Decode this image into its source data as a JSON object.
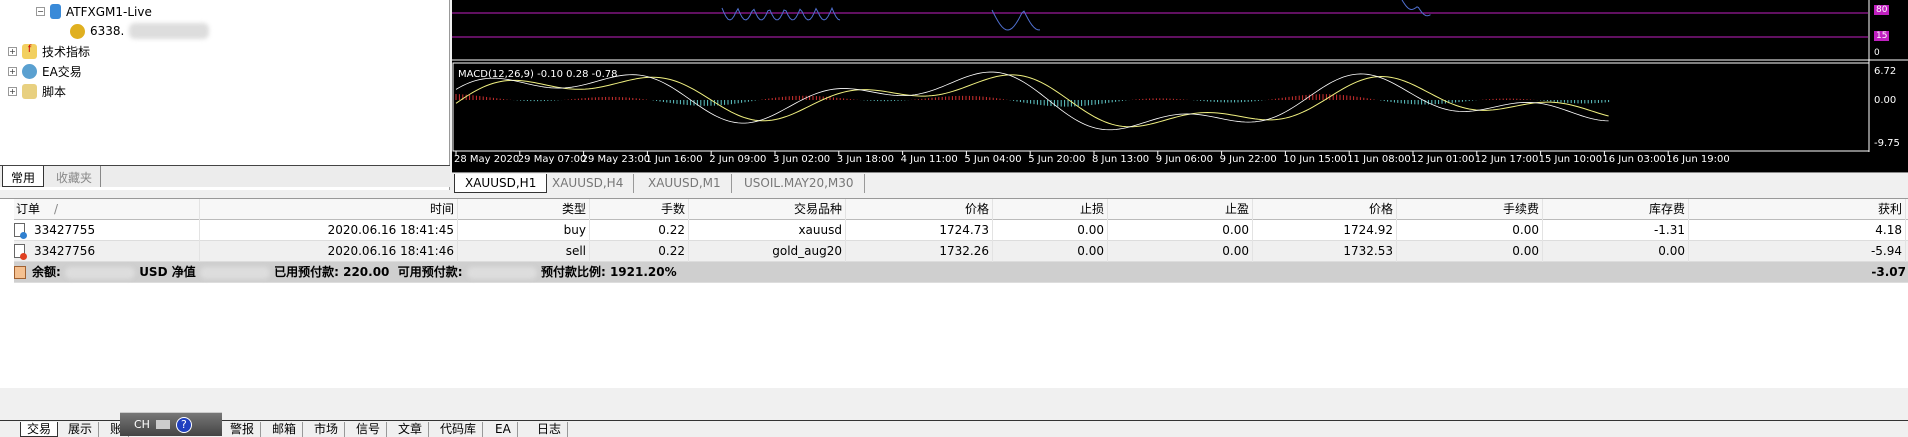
{
  "navigator": {
    "server": "ATFXGM1-Live",
    "account": "6338.",
    "items": [
      {
        "label": "技术指标"
      },
      {
        "label": "EA交易"
      },
      {
        "label": "脚本"
      }
    ],
    "tabs": [
      "常用",
      "收藏夹"
    ]
  },
  "chart": {
    "rsi_levels": [
      "80",
      "15",
      "0"
    ],
    "macd_label": "MACD(12,26,9) -0.10 0.28 -0.78",
    "macd_axis": [
      "6.72",
      "0.00",
      "-9.75"
    ],
    "time_labels": [
      "28 May 2020",
      "29 May 07:00",
      "29 May 23:00",
      "1 Jun 16:00",
      "2 Jun 09:00",
      "3 Jun 02:00",
      "3 Jun 18:00",
      "4 Jun 11:00",
      "5 Jun 04:00",
      "5 Jun 20:00",
      "8 Jun 13:00",
      "9 Jun 06:00",
      "9 Jun 22:00",
      "10 Jun 15:00",
      "11 Jun 08:00",
      "12 Jun 01:00",
      "12 Jun 17:00",
      "15 Jun 10:00",
      "16 Jun 03:00",
      "16 Jun 19:00"
    ],
    "tabs": [
      "XAUUSD,H1",
      "XAUUSD,H4",
      "XAUUSD,M1",
      "USOIL.MAY20,M30"
    ],
    "colors": {
      "bull": "#d03030",
      "bear": "#60c8c8",
      "signal": "#f0f080",
      "main": "#ffffff",
      "level": "#c020c0"
    }
  },
  "trade": {
    "headers": [
      "订单",
      "时间",
      "类型",
      "手数",
      "交易品种",
      "价格",
      "止损",
      "止盈",
      "价格",
      "手续费",
      "库存费",
      "获利"
    ],
    "sort_indicator": "/",
    "rows": [
      {
        "cells": [
          "33427755",
          "2020.06.16 18:41:45",
          "buy",
          "0.22",
          "xauusd",
          "1724.73",
          "0.00",
          "0.00",
          "1724.92",
          "0.00",
          "-1.31",
          "4.18"
        ]
      },
      {
        "cells": [
          "33427756",
          "2020.06.16 18:41:46",
          "sell",
          "0.22",
          "gold_aug20",
          "1732.26",
          "0.00",
          "0.00",
          "1732.53",
          "0.00",
          "0.00",
          "-5.94"
        ]
      }
    ],
    "summary": {
      "balance_label": "余额:",
      "currency": "USD",
      "equity_label": "净值",
      "margin_label": "已用预付款: 220.00",
      "free_label": "可用预付款:",
      "level_label": "预付款比例: 1921.20%",
      "total": "-3.07"
    }
  },
  "bottom_tabs": [
    "交易",
    "展示",
    "账",
    "警报",
    "邮箱",
    "市场",
    "信号",
    "文章",
    "代码库",
    "EA",
    "日志"
  ],
  "ime": {
    "lang": "CH",
    "help": "?"
  }
}
